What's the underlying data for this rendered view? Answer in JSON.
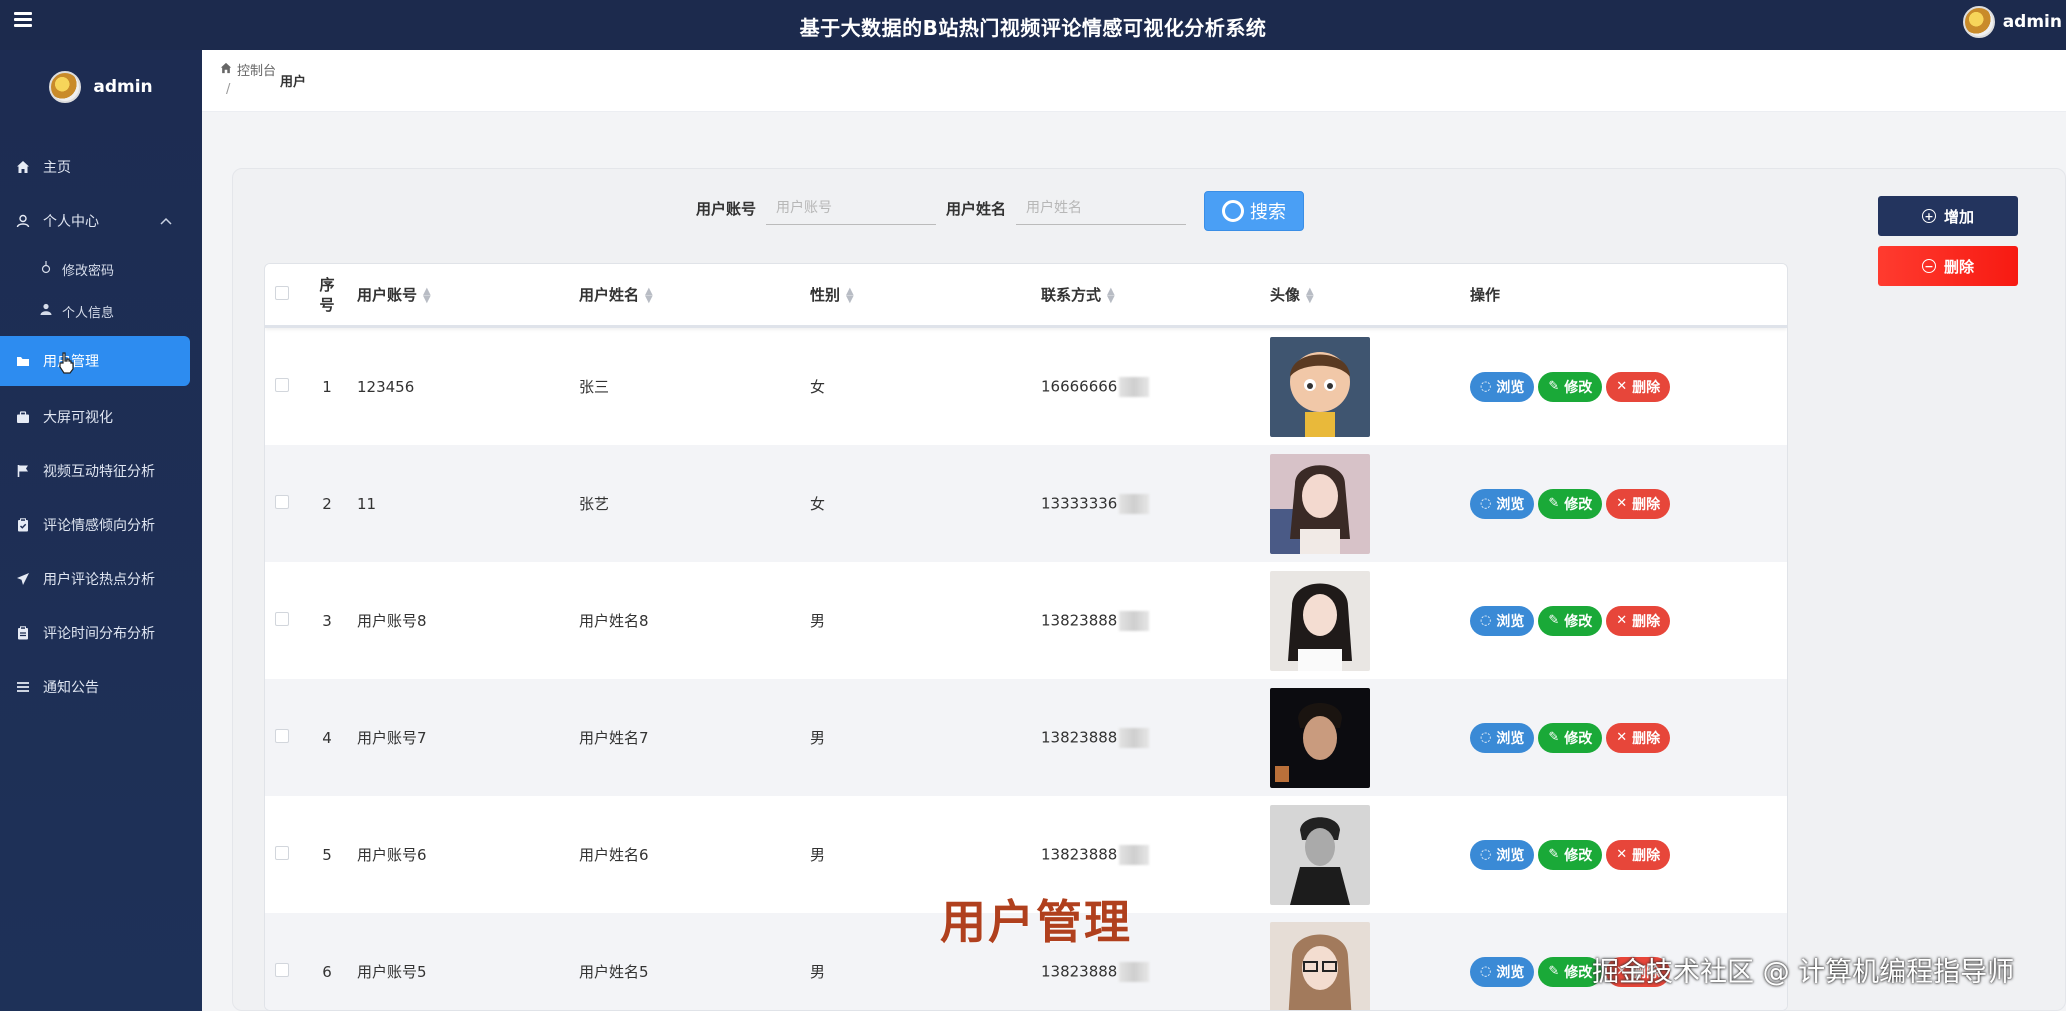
{
  "header": {
    "title": "基于大数据的B站热门视频评论情感可视化分析系统",
    "username": "admin"
  },
  "sidebar": {
    "brand": "admin",
    "items": [
      {
        "label": "主页",
        "icon": "home-icon"
      },
      {
        "label": "个人中心",
        "icon": "user-icon"
      },
      {
        "label": "修改密码",
        "icon": "lock-icon"
      },
      {
        "label": "个人信息",
        "icon": "person-icon"
      },
      {
        "label": "用户管理",
        "icon": "folder-icon"
      },
      {
        "label": "大屏可视化",
        "icon": "briefcase-icon"
      },
      {
        "label": "视频互动特征分析",
        "icon": "flag-icon"
      },
      {
        "label": "评论情感倾向分析",
        "icon": "clipboard-icon"
      },
      {
        "label": "用户评论热点分析",
        "icon": "send-icon"
      },
      {
        "label": "评论时间分布分析",
        "icon": "clipboard-list-icon"
      },
      {
        "label": "通知公告",
        "icon": "list-icon"
      }
    ]
  },
  "breadcrumb": {
    "home": "控制台",
    "separator": "/",
    "current": "用户"
  },
  "search": {
    "account_label": "用户账号",
    "account_placeholder": "用户账号",
    "name_label": "用户姓名",
    "name_placeholder": "用户姓名",
    "button": "搜索"
  },
  "actions": {
    "add": "增加",
    "delete": "删除"
  },
  "table": {
    "headers": {
      "index": "序号",
      "account": "用户账号",
      "name": "用户姓名",
      "sex": "性别",
      "phone": "联系方式",
      "avatar": "头像",
      "ops": "操作"
    },
    "op_labels": {
      "view": "浏览",
      "edit": "修改",
      "delete": "删除"
    },
    "rows": [
      {
        "index": "1",
        "account": "123456",
        "name": "张三",
        "sex": "女",
        "phone": "16666666"
      },
      {
        "index": "2",
        "account": "11",
        "name": "张艺",
        "sex": "女",
        "phone": "13333336"
      },
      {
        "index": "3",
        "account": "用户账号8",
        "name": "用户姓名8",
        "sex": "男",
        "phone": "13823888"
      },
      {
        "index": "4",
        "account": "用户账号7",
        "name": "用户姓名7",
        "sex": "男",
        "phone": "13823888"
      },
      {
        "index": "5",
        "account": "用户账号6",
        "name": "用户姓名6",
        "sex": "男",
        "phone": "13823888"
      },
      {
        "index": "6",
        "account": "用户账号5",
        "name": "用户姓名5",
        "sex": "男",
        "phone": "13823888"
      }
    ]
  },
  "overlay": {
    "caption": "用户管理",
    "watermark": "掘金技术社区 @ 计算机编程指导师"
  },
  "colors": {
    "topbar": "#1c2a4d",
    "sidebar": "#1d2c52",
    "active_menu": "#2d8cf0",
    "search_button": "#4a9ff5",
    "add_button": "#23345e",
    "delete_button": "#ff3b2f",
    "view_op": "#3a8ad6",
    "edit_op": "#1aa938",
    "delete_op": "#e7463a"
  }
}
